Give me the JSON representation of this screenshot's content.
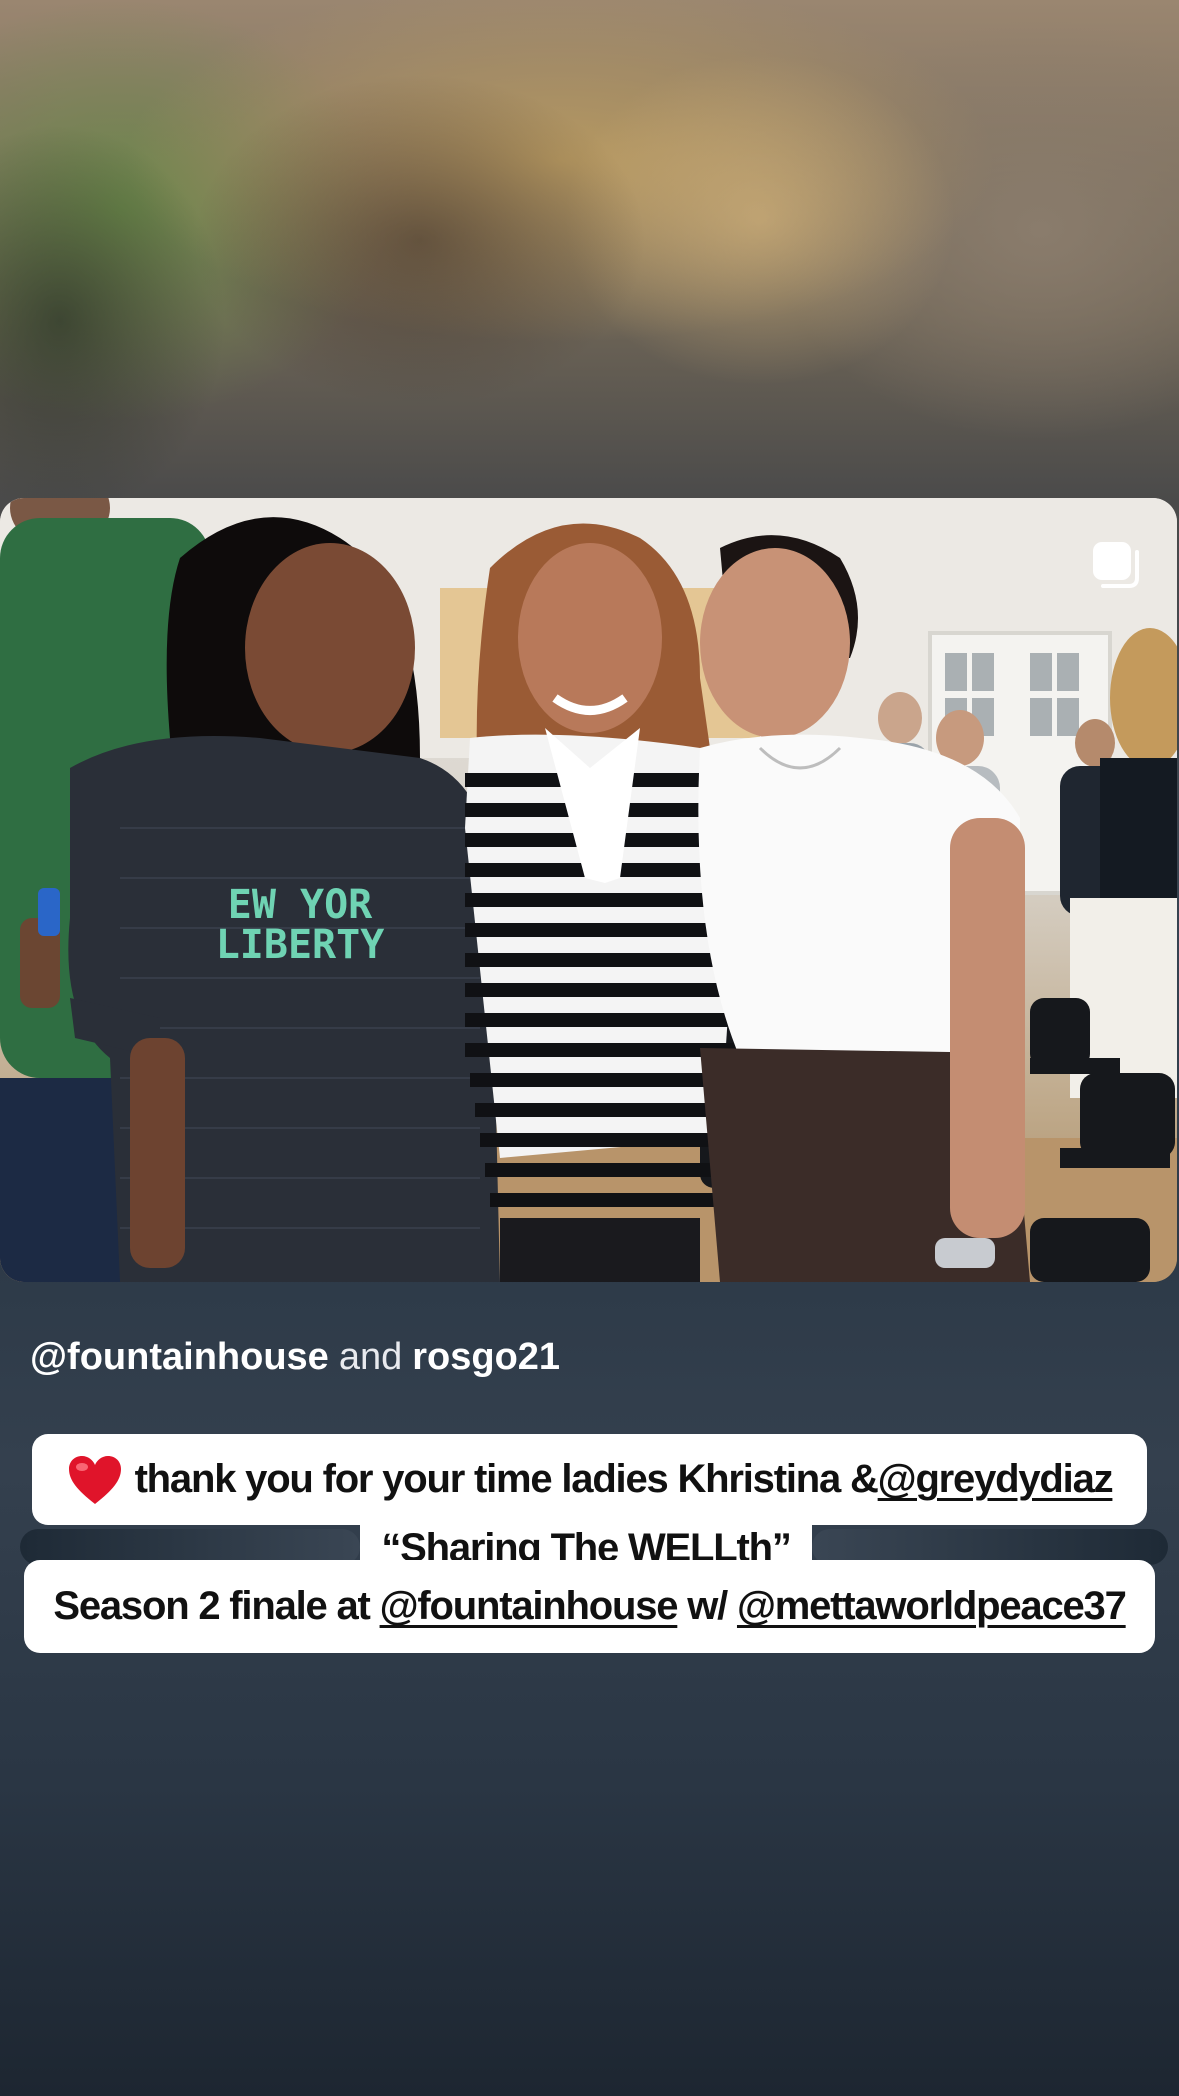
{
  "story": {
    "photo": {
      "alt_icon": "multiple-photos-icon"
    },
    "mentions": {
      "primary": "@fountainhouse",
      "connector": "and",
      "secondary": "rosgo21"
    },
    "caption": {
      "line1_emoji": "heart-icon",
      "line1_text": "thank you for your time ladies Khristina & ",
      "line1_mention": "@greydydiaz",
      "line2_text": "“Sharing The WELLth”",
      "line3_prefix": "Season 2 finale at ",
      "line3_mention1": "@fountainhouse",
      "line3_mid": " w/ ",
      "line3_mention2": "@mettaworldpeace37"
    },
    "colors": {
      "caption_bg": "#ffffff",
      "caption_text": "#111111",
      "heart": "#e0142a"
    }
  }
}
